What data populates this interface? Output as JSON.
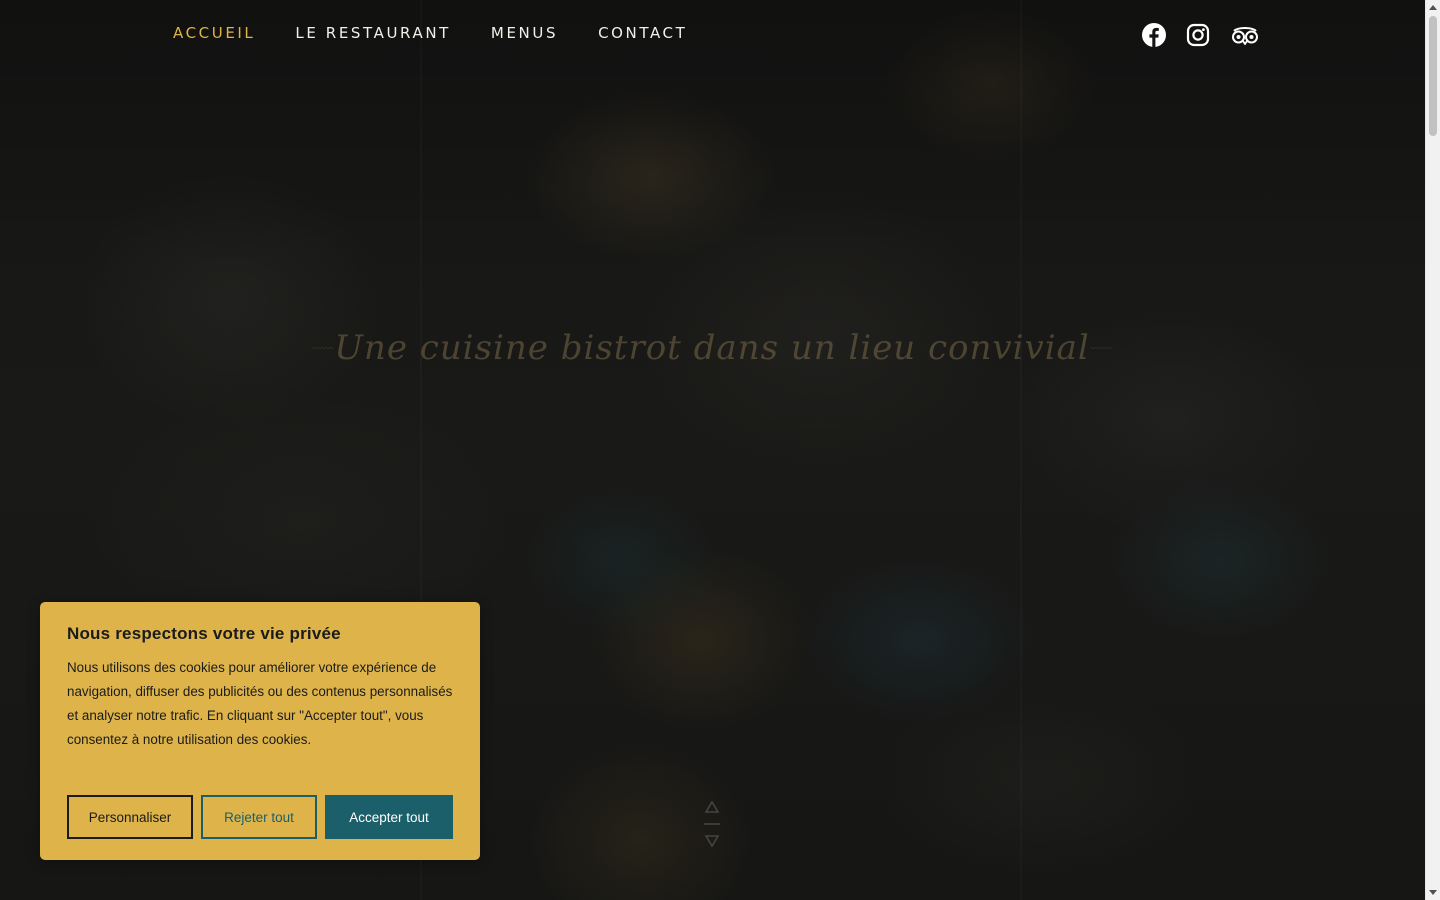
{
  "nav": {
    "items": [
      {
        "label": "ACCUEIL",
        "active": true
      },
      {
        "label": "LE RESTAURANT",
        "active": false
      },
      {
        "label": "MENUS",
        "active": false
      },
      {
        "label": "CONTACT",
        "active": false
      }
    ]
  },
  "social": [
    "facebook-icon",
    "instagram-icon",
    "tripadvisor-icon"
  ],
  "hero": {
    "headline": "Une cuisine bistrot dans un lieu convivial"
  },
  "cookie_banner": {
    "title": "Nous respectons votre vie privée",
    "text": "Nous utilisons des cookies pour améliorer votre expérience de navigation, diffuser des publicités ou des contenus personnalisés et analyser notre trafic. En cliquant sur \"Accepter tout\", vous consentez à notre utilisation des cookies.",
    "buttons": {
      "customize": "Personnaliser",
      "reject": "Rejeter tout",
      "accept": "Accepter tout"
    }
  },
  "colors": {
    "accent": "#e0b547",
    "banner_bg": "#deb44a",
    "button_teal": "#1b5f6a",
    "nav_text": "#f2f0ea"
  }
}
